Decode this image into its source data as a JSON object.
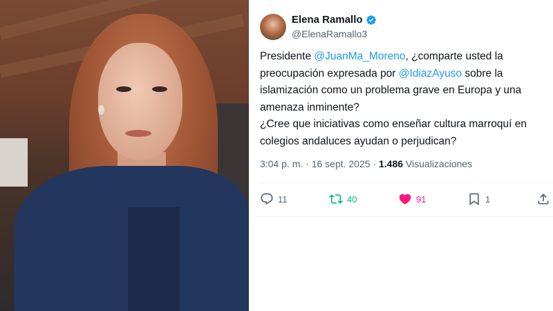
{
  "tweet": {
    "author_name": "Elena Ramallo",
    "author_handle": "@ElenaRamallo3",
    "text": {
      "p1_a": "Presidente ",
      "p1_mention1": "@JuanMa_Moreno",
      "p1_b": ", ¿comparte usted la preocupación expresada por ",
      "p1_mention2": "@IdiazAyuso",
      "p1_c": " sobre la islamización como un problema grave en Europa y una amenaza inminente?",
      "p2": "¿Cree que iniciativas como enseñar cultura marroquí en colegios andaluces ayudan o perjudican?"
    },
    "timestamp": "3:04 p. m. · 16 sept. 2025 · ",
    "views_count": "1.486",
    "views_label": " Visualizaciones",
    "actions": {
      "replies": "11",
      "retweets": "40",
      "likes": "91",
      "bookmarks": "1"
    }
  },
  "colors": {
    "mention": "#1d9bf0",
    "retweet": "#00ba7c",
    "like": "#f91880",
    "verified": "#1d9bf0"
  },
  "icons": [
    "verified-badge-icon",
    "reply-icon",
    "retweet-icon",
    "like-heart-icon",
    "bookmark-icon",
    "share-icon"
  ]
}
